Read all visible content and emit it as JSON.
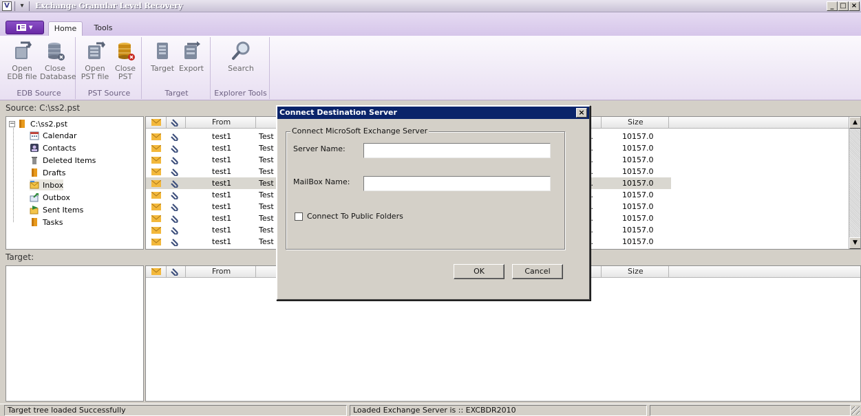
{
  "window": {
    "title": "Exchange Granular Level Recovery",
    "app_icon": "app-logo-icon",
    "controls": [
      "_",
      "□",
      "×"
    ]
  },
  "ribbon": {
    "app_menu_icon": "menu-grid-icon",
    "tabs": [
      {
        "label": "Home",
        "active": true
      },
      {
        "label": "Tools",
        "active": false
      }
    ],
    "groups": [
      {
        "label": "EDB Source",
        "buttons": [
          {
            "label": "Open EDB file",
            "l1": "Open",
            "l2": "EDB file",
            "icon": "open-edb-icon"
          },
          {
            "label": "Close Database",
            "l1": "Close",
            "l2": "Database",
            "icon": "close-database-icon"
          }
        ]
      },
      {
        "label": "PST Source",
        "buttons": [
          {
            "label": "Open PST file",
            "l1": "Open",
            "l2": "PST file",
            "icon": "open-pst-icon"
          },
          {
            "label": "Close PST",
            "l1": "Close",
            "l2": "PST",
            "icon": "close-pst-icon"
          }
        ]
      },
      {
        "label": "Target",
        "buttons": [
          {
            "label": "Target",
            "l1": "Target",
            "l2": "",
            "icon": "target-icon"
          },
          {
            "label": "Export",
            "l1": "Export",
            "l2": "",
            "icon": "export-icon"
          }
        ]
      },
      {
        "label": "Explorer Tools",
        "buttons": [
          {
            "label": "Search",
            "l1": "Search",
            "l2": "",
            "icon": "search-icon"
          }
        ]
      }
    ]
  },
  "source": {
    "label": "Source: C:\\ss2.pst",
    "tree": {
      "root": "C:\\ss2.pst",
      "items": [
        "Calendar",
        "Contacts",
        "Deleted Items",
        "Drafts",
        "Inbox",
        "Outbox",
        "Sent Items",
        "Tasks"
      ],
      "selected": "Inbox"
    },
    "columns": {
      "from": "From",
      "size": "Size"
    },
    "rows": [
      {
        "from": "test1",
        "subject": "Test",
        "trunc": "..",
        "size": "10157.0"
      },
      {
        "from": "test1",
        "subject": "Test",
        "trunc": "..",
        "size": "10157.0"
      },
      {
        "from": "test1",
        "subject": "Test",
        "trunc": "..",
        "size": "10157.0"
      },
      {
        "from": "test1",
        "subject": "Test",
        "trunc": "..",
        "size": "10157.0"
      },
      {
        "from": "test1",
        "subject": "Test",
        "trunc": "..",
        "size": "10157.0"
      },
      {
        "from": "test1",
        "subject": "Test",
        "trunc": "..",
        "size": "10157.0"
      },
      {
        "from": "test1",
        "subject": "Test",
        "trunc": "..",
        "size": "10157.0"
      },
      {
        "from": "test1",
        "subject": "Test",
        "trunc": "..",
        "size": "10157.0"
      },
      {
        "from": "test1",
        "subject": "Test",
        "trunc": "..",
        "size": "10157.0"
      },
      {
        "from": "test1",
        "subject": "Test",
        "trunc": "..",
        "size": "10157.0"
      }
    ]
  },
  "target": {
    "label": "Target:",
    "columns": {
      "from": "From",
      "size": "Size"
    }
  },
  "dialog": {
    "title": "Connect Destination Server",
    "close_label": "×",
    "group_label": "Connect MicroSoft Exchange Server",
    "server_label": "Server Name:",
    "server_value": "",
    "mailbox_label": "MailBox Name:",
    "mailbox_value": "",
    "public_folders_label": "Connect To Public Folders",
    "public_folders_checked": false,
    "ok_label": "OK",
    "cancel_label": "Cancel"
  },
  "status": {
    "left": "Target tree loaded Successfully",
    "middle": "Loaded Exchange Server is :: EXCBDR2010",
    "right": ""
  },
  "colors": {
    "ribbon_accent": "#7a3fb8",
    "dialog_title": "#0a246a",
    "selected_row": "#d9d7d0"
  }
}
